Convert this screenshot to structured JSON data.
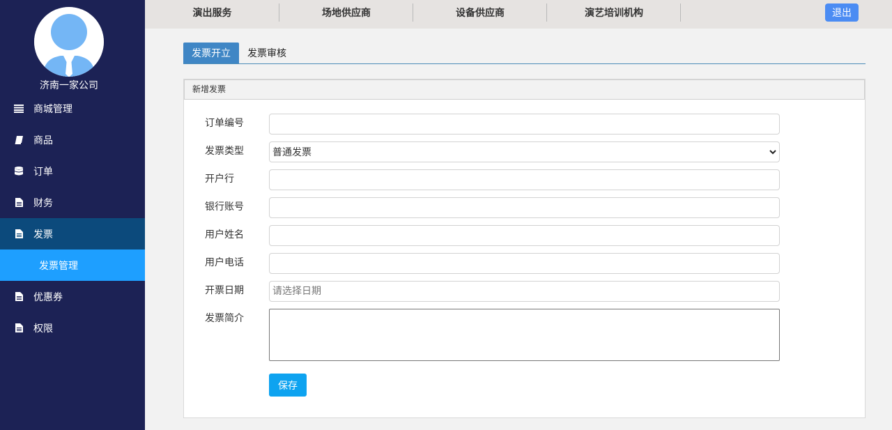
{
  "sidebar": {
    "company_name": "济南一家公司",
    "items": [
      {
        "label": "商城管理",
        "icon": "list-icon"
      },
      {
        "label": "商品",
        "icon": "book-icon"
      },
      {
        "label": "订单",
        "icon": "database-icon"
      },
      {
        "label": "财务",
        "icon": "file-icon"
      },
      {
        "label": "发票",
        "icon": "file-icon"
      },
      {
        "label": "发票管理"
      },
      {
        "label": "优惠券",
        "icon": "file-icon"
      },
      {
        "label": "权限",
        "icon": "file-icon"
      }
    ]
  },
  "topbar": {
    "nav": [
      "演出服务",
      "场地供应商",
      "设备供应商",
      "演艺培训机构"
    ],
    "logout_label": "退出"
  },
  "tabs": [
    "发票开立",
    "发票审核"
  ],
  "panel": {
    "title": "新增发票",
    "fields": {
      "order_no": {
        "label": "订单编号",
        "value": ""
      },
      "invoice_type": {
        "label": "发票类型",
        "value": "普通发票"
      },
      "bank": {
        "label": "开户行",
        "value": ""
      },
      "account": {
        "label": "银行账号",
        "value": ""
      },
      "user_name": {
        "label": "用户姓名",
        "value": ""
      },
      "user_phone": {
        "label": "用户电话",
        "value": ""
      },
      "date": {
        "label": "开票日期",
        "placeholder": "请选择日期"
      },
      "intro": {
        "label": "发票简介",
        "value": ""
      }
    },
    "save_label": "保存"
  },
  "colors": {
    "sidebar_bg": "#1c2255",
    "active_menu": "#0c4a7c",
    "sub_menu": "#1e9fff",
    "tab_active": "#3f86c5",
    "save_button": "#0ea3f0",
    "logout_button": "#4b8cf3"
  }
}
